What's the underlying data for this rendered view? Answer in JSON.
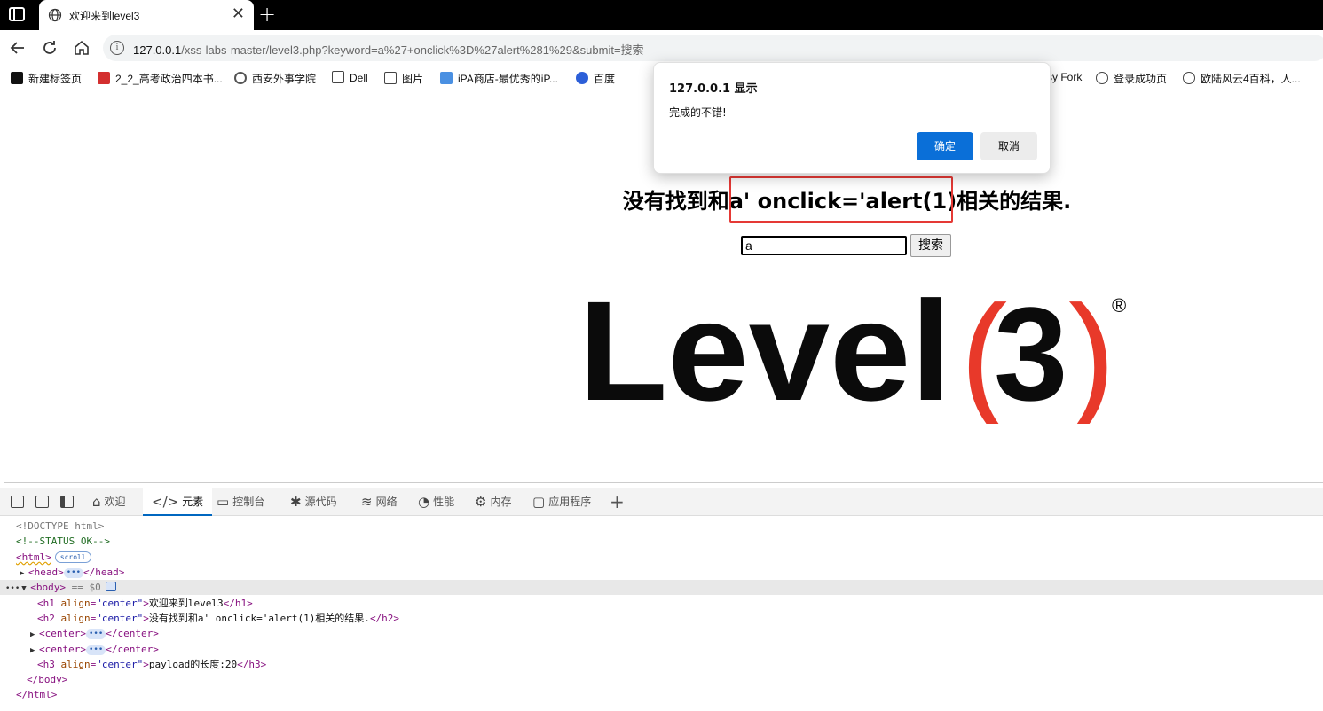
{
  "browser": {
    "tab_title": "欢迎来到level3",
    "tab_close": "✕",
    "new_tab": "+",
    "url_host": "127.0.0.1",
    "url_rest": "/xss-labs-master/level3.php?keyword=a%27+onclick%3D%27alert%281%29&submit=搜索"
  },
  "bookmarks": [
    {
      "label": "新建标签页",
      "icon": "square-icon"
    },
    {
      "label": "2_2_高考政治四本书...",
      "icon": "pdf-icon"
    },
    {
      "label": "西安外事学院",
      "icon": "school-icon"
    },
    {
      "label": "Dell",
      "icon": "folder-icon"
    },
    {
      "label": "图片",
      "icon": "folder-icon"
    },
    {
      "label": "iPA商店-最优秀的iP...",
      "icon": "cube-icon"
    },
    {
      "label": "百度",
      "icon": "paw-icon"
    },
    {
      "label": "sy Fork",
      "icon": "fork-icon"
    },
    {
      "label": "登录成功页",
      "icon": "globe-icon"
    },
    {
      "label": "欧陆风云4百科，人...",
      "icon": "globe-icon"
    }
  ],
  "page": {
    "heading": "没有找到和a' onclick='alert(1)相关的结果.",
    "search_value": "a",
    "search_button": "搜索",
    "logo_text": "Level",
    "logo_number": "3",
    "logo_paren_left": "(",
    "logo_paren_right": ")",
    "logo_mark": "®"
  },
  "dialog": {
    "title": "127.0.0.1 显示",
    "message": "完成的不错!",
    "ok": "确定",
    "cancel": "取消"
  },
  "devtools": {
    "tabs": [
      {
        "label": "欢迎",
        "glyph": "⌂"
      },
      {
        "label": "元素",
        "glyph": "</>"
      },
      {
        "label": "控制台",
        "glyph": "▭"
      },
      {
        "label": "源代码",
        "glyph": "✱"
      },
      {
        "label": "网络",
        "glyph": "≋"
      },
      {
        "label": "性能",
        "glyph": "◔"
      },
      {
        "label": "内存",
        "glyph": "⚙"
      },
      {
        "label": "应用程序",
        "glyph": "▢"
      }
    ],
    "add": "+",
    "lines": {
      "doctype": "<!DOCTYPE html>",
      "comment": "<!--STATUS OK-->",
      "html_open": "<html>",
      "scroll_pill": "scroll",
      "head_open": "<head>",
      "head_close": "</head>",
      "ellipsis": "•••",
      "body_open": "<body>",
      "body_eq": " == $0",
      "h1_open": "<h1 ",
      "h1_attr": "align",
      "h1_val": "\"center\"",
      "h1_text": "欢迎来到level3",
      "h1_close": "</h1>",
      "h2_open": "<h2 ",
      "h2_attr": "align",
      "h2_val": "\"center\"",
      "h2_text": "没有找到和a' onclick='alert(1)相关的结果.",
      "h2_close": "</h2>",
      "center_open": "<center>",
      "center_close": "</center>",
      "h3_open": "<h3 ",
      "h3_attr": "align",
      "h3_val": "\"center\"",
      "h3_text": "payload的长度:20",
      "h3_close": "</h3>",
      "body_close": "</body>",
      "html_close": "</html>",
      "eq": "=",
      "gt": ">"
    }
  },
  "colors": {
    "accent": "#0a6fd8",
    "highlight": "#e53935",
    "logo_red": "#e8392a"
  }
}
